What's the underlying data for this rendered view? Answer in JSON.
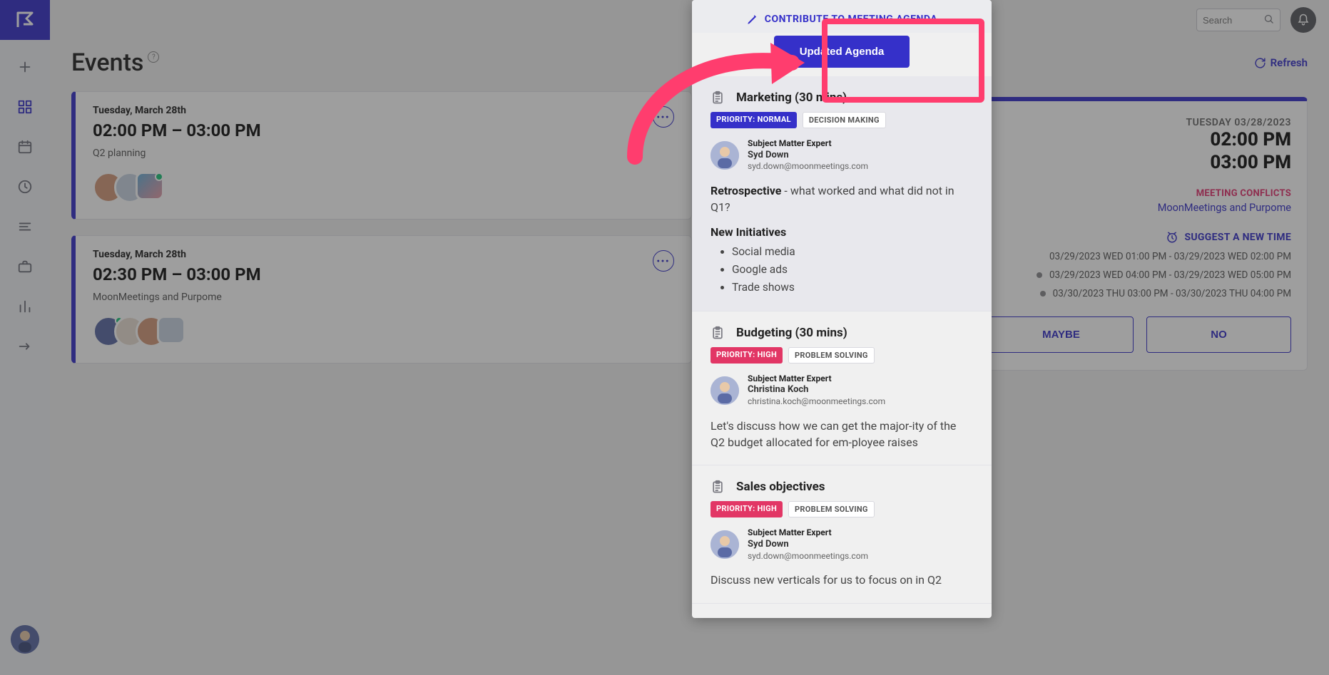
{
  "sidebar": {
    "logo_letter": "F"
  },
  "topbar": {
    "search_placeholder": "Search"
  },
  "header": {
    "title": "Events",
    "refresh_label": "Refresh"
  },
  "events": [
    {
      "date_label": "Tuesday, March 28th",
      "time_label": "02:00 PM – 03:00 PM",
      "subtitle": "Q2 planning"
    },
    {
      "date_label": "Tuesday, March 28th",
      "time_label": "02:30 PM – 03:00 PM",
      "subtitle": "MoonMeetings and Purpome"
    }
  ],
  "agenda": {
    "header_title": "CONTRIBUTE TO MEETING AGENDA",
    "updated_button": "Updated Agenda",
    "items": [
      {
        "title": "Marketing (30 mins)",
        "priority_label": "PRIORITY: NORMAL",
        "priority_class": "priority-normal",
        "category_label": "DECISION MAKING",
        "sme_role": "Subject Matter Expert",
        "sme_name": "Syd Down",
        "sme_email": "syd.down@moonmeetings.com",
        "desc_strong": "Retrospective",
        "desc_rest": " - what worked and what did not in Q1?",
        "subhead": "New Initiatives",
        "bullets": [
          "Social media",
          "Google ads",
          "Trade shows"
        ]
      },
      {
        "title": "Budgeting (30 mins)",
        "priority_label": "PRIORITY: HIGH",
        "priority_class": "priority-high",
        "category_label": "PROBLEM SOLVING",
        "sme_role": "Subject Matter Expert",
        "sme_name": "Christina Koch",
        "sme_email": "christina.koch@moonmeetings.com",
        "desc_plain": "Let's discuss how we can get the major‑ity of the Q2 budget allocated for em‑ployee raises"
      },
      {
        "title": "Sales objectives",
        "priority_label": "PRIORITY: HIGH",
        "priority_class": "priority-high",
        "category_label": "PROBLEM SOLVING",
        "sme_role": "Subject Matter Expert",
        "sme_name": "Syd Down",
        "sme_email": "syd.down@moonmeetings.com",
        "desc_plain": "Discuss new verticals for us to focus on in Q2"
      }
    ]
  },
  "detail": {
    "date_label": "TUESDAY 03/28/2023",
    "start_time": "02:00 PM",
    "end_time": "03:00 PM",
    "conflicts_label": "MEETING CONFLICTS",
    "conflicts_link": "MoonMeetings and Purpome",
    "suggest_label": "SUGGEST A NEW TIME",
    "slots": [
      {
        "text": "03/29/2023 WED 01:00 PM - 03/29/2023 WED 02:00 PM",
        "dot": false
      },
      {
        "text": "03/29/2023 WED 04:00 PM - 03/29/2023 WED 05:00 PM",
        "dot": true
      },
      {
        "text": "03/30/2023 THU 03:00 PM - 03/30/2023 THU 04:00 PM",
        "dot": true
      }
    ],
    "maybe_label": "MAYBE",
    "no_label": "NO"
  }
}
